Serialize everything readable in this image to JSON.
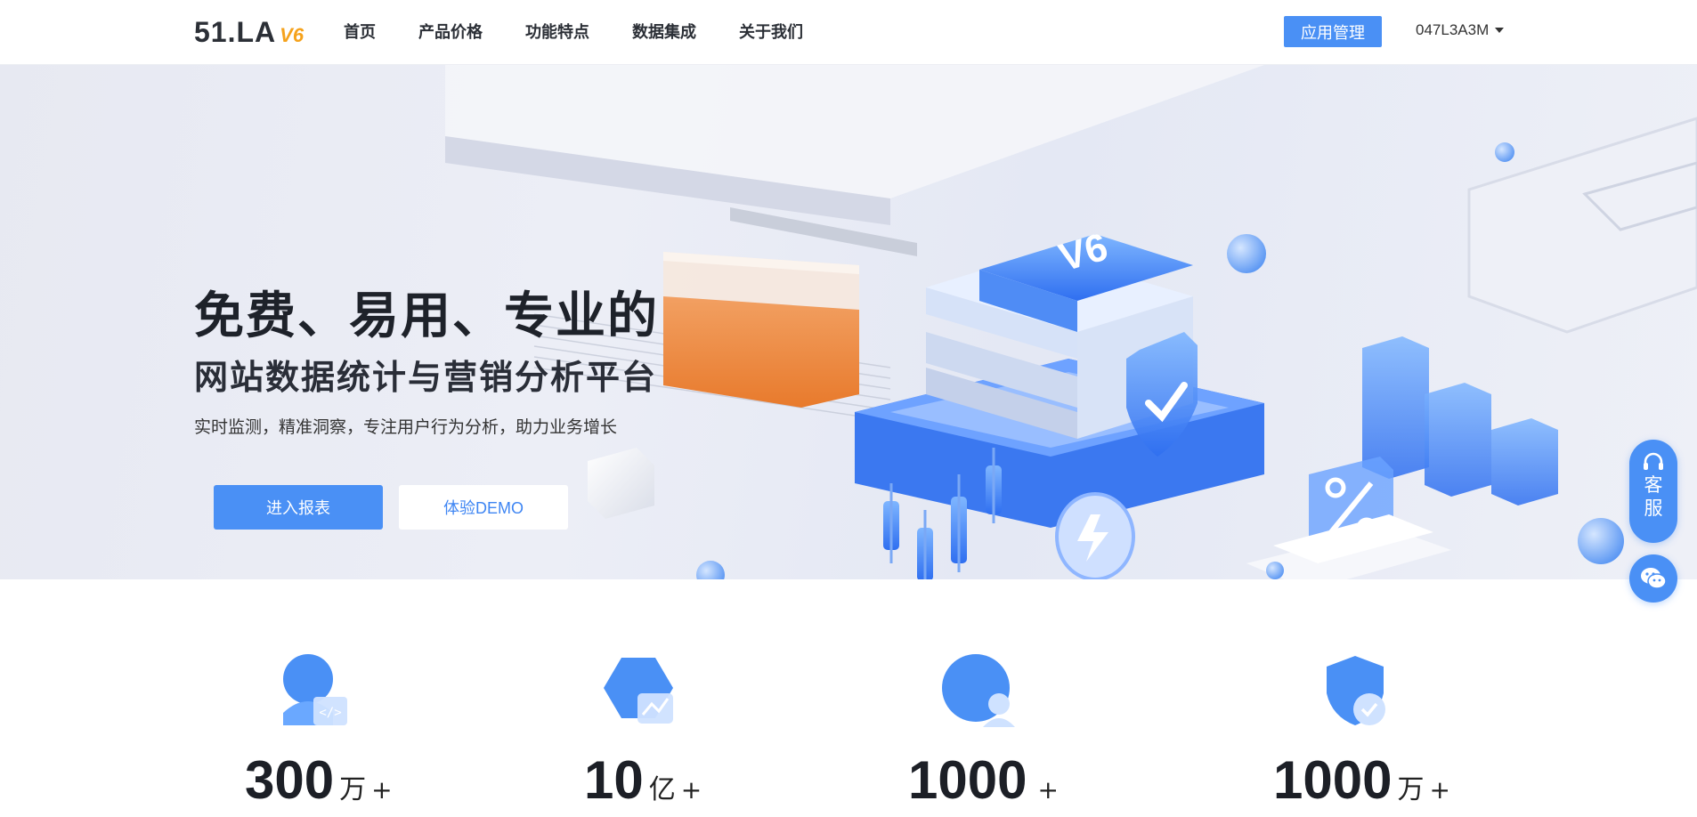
{
  "header": {
    "logo_text": "51.LA",
    "logo_version": "V6",
    "nav": [
      "首页",
      "产品价格",
      "功能特点",
      "数据集成",
      "关于我们"
    ],
    "app_button": "应用管理",
    "user_name": "047L3A3M"
  },
  "hero": {
    "title": "免费、易用、专业的",
    "subtitle": "网站数据统计与营销分析平台",
    "description": "实时监测，精准洞察，专注用户行为分析，助力业务增长",
    "primary_button": "进入报表",
    "secondary_button": "体验DEMO",
    "badge_text": "V6"
  },
  "float": {
    "service_chars": [
      "客",
      "服"
    ]
  },
  "stats": [
    {
      "icon": "user-code-icon",
      "number": "300",
      "unit": "万",
      "plus": "+"
    },
    {
      "icon": "hexagon-chart-icon",
      "number": "10",
      "unit": "亿",
      "plus": "+"
    },
    {
      "icon": "user-circle-icon",
      "number": "1000",
      "unit": "",
      "plus": "+"
    },
    {
      "icon": "shield-check-icon",
      "number": "1000",
      "unit": "万",
      "plus": "+"
    }
  ],
  "colors": {
    "accent": "#4a90f5",
    "logo_version": "#f5a21c",
    "text_dark": "#1e222a"
  }
}
